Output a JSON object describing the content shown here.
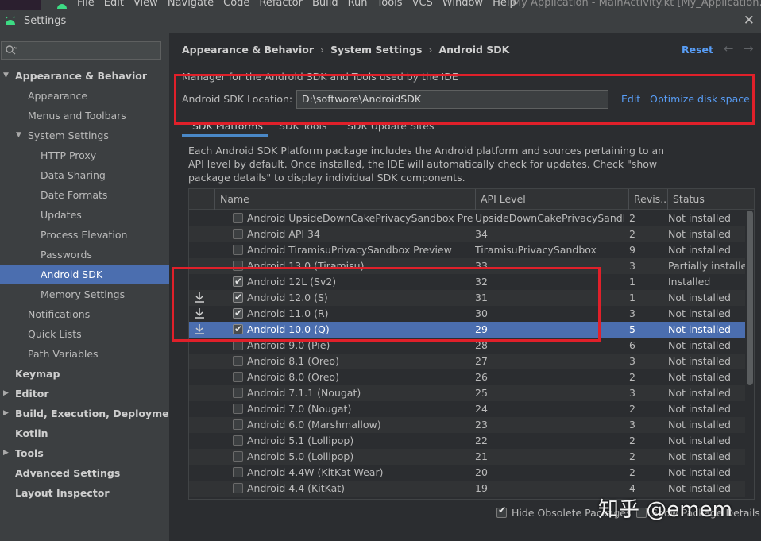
{
  "menubar": {
    "items": [
      "File",
      "Edit",
      "View",
      "Navigate",
      "Code",
      "Refactor",
      "Build",
      "Run",
      "Tools",
      "VCS",
      "Window",
      "Help"
    ],
    "app_title": "My Application - MainActivity.kt [My_Application.app.m"
  },
  "window": {
    "title": "Settings",
    "close_icon": "close-icon"
  },
  "sidebar": {
    "search_placeholder": "",
    "items": [
      {
        "label": "Appearance & Behavior",
        "level": 0,
        "expanded": true,
        "bold": true
      },
      {
        "label": "Appearance",
        "level": 1
      },
      {
        "label": "Menus and Toolbars",
        "level": 1
      },
      {
        "label": "System Settings",
        "level": 1,
        "expanded": true
      },
      {
        "label": "HTTP Proxy",
        "level": 2
      },
      {
        "label": "Data Sharing",
        "level": 2
      },
      {
        "label": "Date Formats",
        "level": 2
      },
      {
        "label": "Updates",
        "level": 2
      },
      {
        "label": "Process Elevation",
        "level": 2
      },
      {
        "label": "Passwords",
        "level": 2
      },
      {
        "label": "Android SDK",
        "level": 2,
        "selected": true
      },
      {
        "label": "Memory Settings",
        "level": 2
      },
      {
        "label": "Notifications",
        "level": 1
      },
      {
        "label": "Quick Lists",
        "level": 1
      },
      {
        "label": "Path Variables",
        "level": 1
      },
      {
        "label": "Keymap",
        "level": 0,
        "bold": true
      },
      {
        "label": "Editor",
        "level": 0,
        "collapsed": true,
        "bold": true
      },
      {
        "label": "Build, Execution, Deployment",
        "level": 0,
        "collapsed": true,
        "bold": true
      },
      {
        "label": "Kotlin",
        "level": 0,
        "bold": true
      },
      {
        "label": "Tools",
        "level": 0,
        "collapsed": true,
        "bold": true
      },
      {
        "label": "Advanced Settings",
        "level": 0,
        "bold": true
      },
      {
        "label": "Layout Inspector",
        "level": 0,
        "bold": true
      }
    ]
  },
  "main": {
    "breadcrumb": [
      "Appearance & Behavior",
      "System Settings",
      "Android SDK"
    ],
    "reset_label": "Reset",
    "description": "Manager for the Android SDK and Tools used by the IDE",
    "sdk_location_label": "Android SDK Location:",
    "sdk_location_value": "D:\\softwore\\AndroidSDK",
    "edit_label": "Edit",
    "optimize_label": "Optimize disk space",
    "tabs": [
      "SDK Platforms",
      "SDK Tools",
      "SDK Update Sites"
    ],
    "info_text": "Each Android SDK Platform package includes the Android platform and sources pertaining to an API level by default. Once installed, the IDE will automatically check for updates. Check \"show package details\" to display individual SDK components.",
    "table": {
      "headers": [
        "Name",
        "API Level",
        "Revis...",
        "Status"
      ],
      "rows": [
        {
          "name": "Android UpsideDownCakePrivacySandbox Preview",
          "api": "UpsideDownCakePrivacySandbox",
          "rev": "2",
          "status": "Not installed",
          "checked": false,
          "download": false
        },
        {
          "name": "Android API 34",
          "api": "34",
          "rev": "2",
          "status": "Not installed",
          "checked": false,
          "download": false
        },
        {
          "name": "Android TiramisuPrivacySandbox Preview",
          "api": "TiramisuPrivacySandbox",
          "rev": "9",
          "status": "Not installed",
          "checked": false,
          "download": false
        },
        {
          "name": "Android 13.0 (Tiramisu)",
          "api": "33",
          "rev": "3",
          "status": "Partially installed",
          "checked": false,
          "download": false
        },
        {
          "name": "Android 12L (Sv2)",
          "api": "32",
          "rev": "1",
          "status": "Installed",
          "checked": true,
          "download": false
        },
        {
          "name": "Android 12.0 (S)",
          "api": "31",
          "rev": "1",
          "status": "Not installed",
          "checked": true,
          "download": true
        },
        {
          "name": "Android 11.0 (R)",
          "api": "30",
          "rev": "3",
          "status": "Not installed",
          "checked": true,
          "download": true
        },
        {
          "name": "Android 10.0 (Q)",
          "api": "29",
          "rev": "5",
          "status": "Not installed",
          "checked": true,
          "download": true,
          "selected": true
        },
        {
          "name": "Android 9.0 (Pie)",
          "api": "28",
          "rev": "6",
          "status": "Not installed",
          "checked": false,
          "download": false
        },
        {
          "name": "Android 8.1 (Oreo)",
          "api": "27",
          "rev": "3",
          "status": "Not installed",
          "checked": false,
          "download": false
        },
        {
          "name": "Android 8.0 (Oreo)",
          "api": "26",
          "rev": "2",
          "status": "Not installed",
          "checked": false,
          "download": false
        },
        {
          "name": "Android 7.1.1 (Nougat)",
          "api": "25",
          "rev": "3",
          "status": "Not installed",
          "checked": false,
          "download": false
        },
        {
          "name": "Android 7.0 (Nougat)",
          "api": "24",
          "rev": "2",
          "status": "Not installed",
          "checked": false,
          "download": false
        },
        {
          "name": "Android 6.0 (Marshmallow)",
          "api": "23",
          "rev": "3",
          "status": "Not installed",
          "checked": false,
          "download": false
        },
        {
          "name": "Android 5.1 (Lollipop)",
          "api": "22",
          "rev": "2",
          "status": "Not installed",
          "checked": false,
          "download": false
        },
        {
          "name": "Android 5.0 (Lollipop)",
          "api": "21",
          "rev": "2",
          "status": "Not installed",
          "checked": false,
          "download": false
        },
        {
          "name": "Android 4.4W (KitKat Wear)",
          "api": "20",
          "rev": "2",
          "status": "Not installed",
          "checked": false,
          "download": false
        },
        {
          "name": "Android 4.4 (KitKat)",
          "api": "19",
          "rev": "4",
          "status": "Not installed",
          "checked": false,
          "download": false
        }
      ]
    },
    "hide_obsolete_label": "Hide Obsolete Packages",
    "show_details_label": "Show Package Details"
  },
  "watermark": "知乎 @emem",
  "colors": {
    "accent": "#589df6",
    "selection": "#4b6eaf",
    "annotation": "#e0202a",
    "background": "#2b2d30",
    "panel": "#3c3f41"
  }
}
